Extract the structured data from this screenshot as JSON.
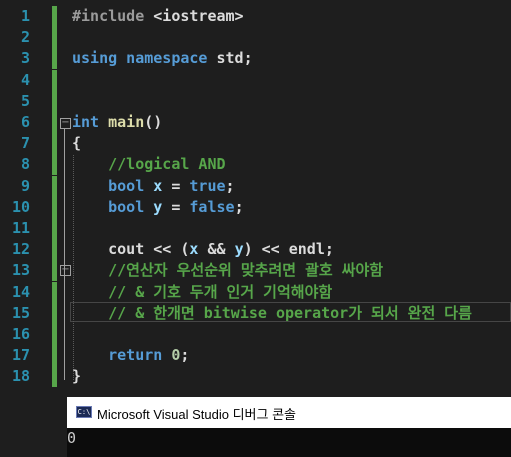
{
  "editor": {
    "lines": [
      {
        "num": "1",
        "tokens": [
          [
            "pp",
            "#include "
          ],
          [
            "str",
            "<iostream>"
          ]
        ]
      },
      {
        "num": "2",
        "tokens": []
      },
      {
        "num": "3",
        "tokens": [
          [
            "kw",
            "using namespace "
          ],
          [
            "txt",
            "std;"
          ]
        ]
      },
      {
        "num": "4",
        "tokens": []
      },
      {
        "num": "5",
        "tokens": []
      },
      {
        "num": "6",
        "tokens": [
          [
            "kw",
            "int "
          ],
          [
            "fn",
            "main"
          ],
          [
            "txt",
            "()"
          ]
        ]
      },
      {
        "num": "7",
        "tokens": [
          [
            "txt",
            "{"
          ]
        ]
      },
      {
        "num": "8",
        "tokens": [
          [
            "txt",
            "    "
          ],
          [
            "cm",
            "//logical AND"
          ]
        ]
      },
      {
        "num": "9",
        "tokens": [
          [
            "txt",
            "    "
          ],
          [
            "kw",
            "bool "
          ],
          [
            "vr",
            "x"
          ],
          [
            "txt",
            " = "
          ],
          [
            "kw",
            "true"
          ],
          [
            "txt",
            ";"
          ]
        ]
      },
      {
        "num": "10",
        "tokens": [
          [
            "txt",
            "    "
          ],
          [
            "kw",
            "bool "
          ],
          [
            "vr",
            "y"
          ],
          [
            "txt",
            " = "
          ],
          [
            "kw",
            "false"
          ],
          [
            "txt",
            ";"
          ]
        ]
      },
      {
        "num": "11",
        "tokens": []
      },
      {
        "num": "12",
        "tokens": [
          [
            "txt",
            "    cout << ("
          ],
          [
            "vr",
            "x"
          ],
          [
            "txt",
            " && "
          ],
          [
            "vr",
            "y"
          ],
          [
            "txt",
            ") << endl;"
          ]
        ]
      },
      {
        "num": "13",
        "tokens": [
          [
            "txt",
            "    "
          ],
          [
            "cm",
            "//연산자 우선순위 맞추려면 괄호 싸야함"
          ]
        ]
      },
      {
        "num": "14",
        "tokens": [
          [
            "txt",
            "    "
          ],
          [
            "cm",
            "// & 기호 두개 인거 기억해야함"
          ]
        ]
      },
      {
        "num": "15",
        "tokens": [
          [
            "txt",
            "    "
          ],
          [
            "cm",
            "// & 한개면 bitwise operator가 되서 완전 다름"
          ]
        ]
      },
      {
        "num": "16",
        "tokens": []
      },
      {
        "num": "17",
        "tokens": [
          [
            "txt",
            "    "
          ],
          [
            "kw",
            "return "
          ],
          [
            "nm",
            "0"
          ],
          [
            "txt",
            ";"
          ]
        ]
      },
      {
        "num": "18",
        "tokens": [
          [
            "txt",
            "}"
          ]
        ]
      }
    ]
  },
  "console": {
    "title": "Microsoft Visual Studio 디버그 콘솔",
    "icon": "console-window-icon",
    "output": "0"
  }
}
